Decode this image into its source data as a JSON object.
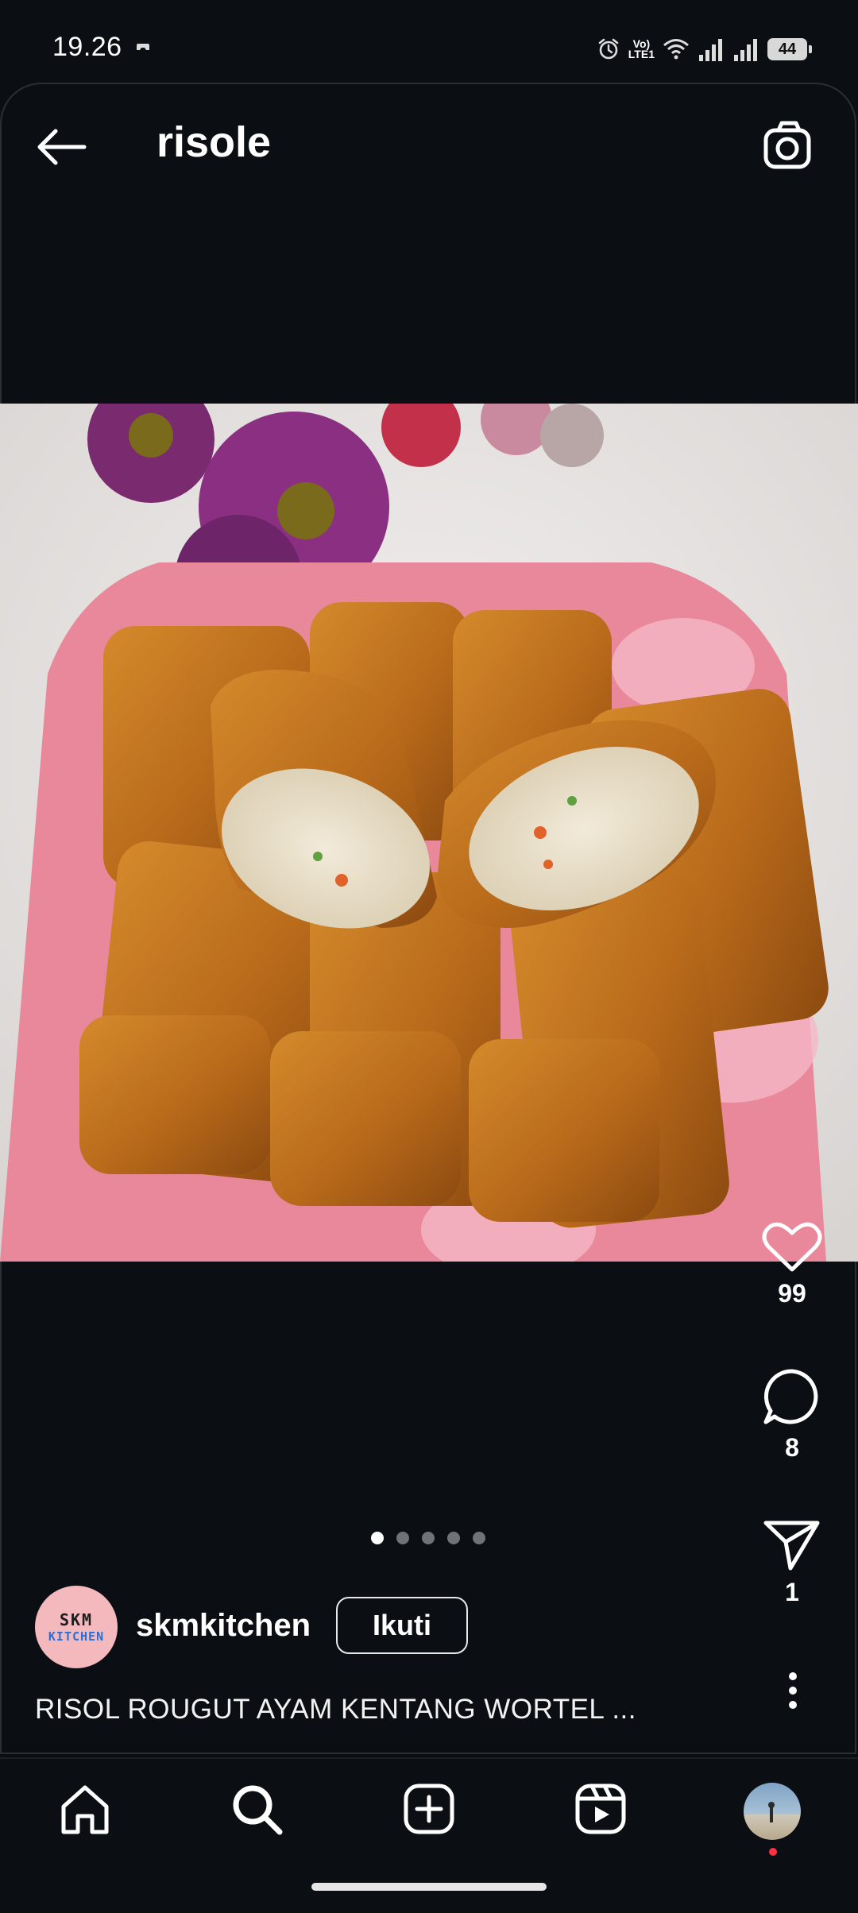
{
  "status_bar": {
    "time": "19.26",
    "volte_label_top": "Vo)",
    "volte_label_bottom": "LTE1",
    "battery": "44"
  },
  "header": {
    "title": "risole"
  },
  "post": {
    "likes": "99",
    "comments": "8",
    "shares": "1",
    "carousel": {
      "total": 5,
      "active": 1
    },
    "username": "skmkitchen",
    "follow_label": "Ikuti",
    "caption": "RISOL ROUGUT AYAM KENTANG WORTEL ...",
    "avatar": {
      "line1": "SKM",
      "line2": "KITCHEN"
    }
  },
  "colors": {
    "background": "#0b0f14",
    "notification_dot": "#ff3040",
    "plate": "#e9889a"
  },
  "icons": {
    "back": "arrow-left-icon",
    "camera": "camera-icon",
    "like": "heart-icon",
    "comment": "comment-icon",
    "share": "send-icon",
    "more": "more-vertical-icon",
    "home": "home-icon",
    "search": "search-icon",
    "create": "plus-square-icon",
    "reels": "reels-icon"
  }
}
